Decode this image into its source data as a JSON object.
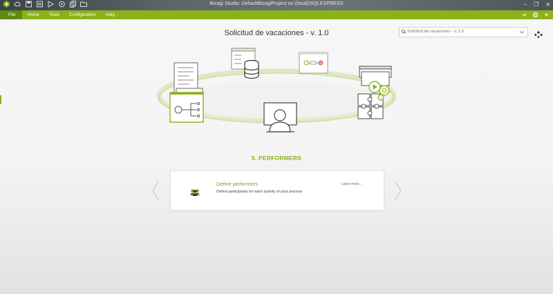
{
  "window": {
    "title": "Bizagi Studio: DefaultBizagiProject  on (local)\\SQLEXPRESS",
    "controls": [
      "–",
      "❐",
      "✕"
    ]
  },
  "quick_access": [
    "bizagi-logo-icon",
    "cloud-icon",
    "save-icon",
    "list-icon",
    "run-icon",
    "play-icon",
    "copy-icon",
    "folder-icon"
  ],
  "menu": {
    "file": "File",
    "items": [
      "Home",
      "Tools",
      "Configuration",
      "Help"
    ],
    "right_icons": [
      "chevron-down-icon",
      "gear-icon",
      "plus-icon"
    ]
  },
  "header": {
    "process_title": "Solicitud de vacaciones - v. 1.0",
    "search_value": "Solicitud de vacaciones - v. 1.0"
  },
  "step": {
    "title": "5. PERFORMERS",
    "card_heading": "Define performers",
    "card_description": "Define participants for each activity of your process",
    "learn_more": "Learn more..."
  },
  "colors": {
    "accent": "#8cb21b",
    "accent_dark": "#5e8a10",
    "titlebar": "#4d5559"
  }
}
